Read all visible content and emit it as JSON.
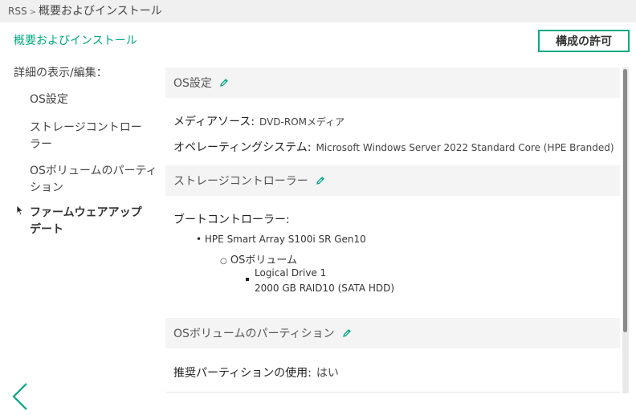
{
  "breadcrumb": {
    "root": "RSS",
    "separator": ">",
    "current": "概要およびインストール"
  },
  "page": {
    "heading": "概要およびインストール",
    "commit_label": "構成の許可"
  },
  "sidebar": {
    "heading": "詳細の表示/編集：",
    "items": [
      {
        "label": "OS設定"
      },
      {
        "label": "ストレージコントローラー"
      },
      {
        "label": "OSボリュームのパーティション"
      },
      {
        "label": "ファームウェアアップデート"
      }
    ]
  },
  "sections": {
    "os": {
      "title": "OS設定",
      "media_label": "メディアソース:",
      "media_value": "DVD-ROMメディア",
      "os_label": "オペレーティングシステム:",
      "os_value": "Microsoft Windows Server 2022 Standard Core (HPE Branded)"
    },
    "storage": {
      "title": "ストレージコントローラー",
      "boot_label": "ブートコントローラー:",
      "controller": "HPE Smart Array S100i SR Gen10",
      "volume_label": "OSボリューム",
      "drive_name": "Logical Drive 1",
      "drive_detail": "2000 GB RAID10 (SATA HDD)"
    },
    "partition": {
      "title": "OSボリュームのパーティション",
      "recommended_label": "推奨パーティションの使用:",
      "recommended_value": "はい"
    }
  },
  "icons": {
    "edit": "pencil-icon",
    "back": "chevron-left-icon",
    "cursor": "mouse-pointer-icon"
  },
  "colors": {
    "accent": "#01a982",
    "section_bg": "#f4f4f4",
    "breadcrumb_bg": "#f0f0f0"
  }
}
